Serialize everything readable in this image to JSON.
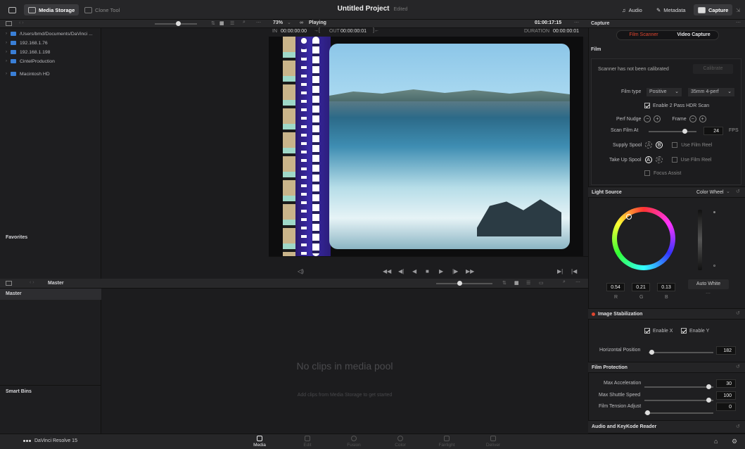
{
  "topbar": {
    "media_storage": "Media Storage",
    "clone_tool": "Clone Tool",
    "project_title": "Untitled Project",
    "edited": "Edited",
    "audio": "Audio",
    "metadata": "Metadata",
    "capture": "Capture"
  },
  "viewer": {
    "zoom": "73%",
    "playing": "Playing",
    "timecode": "01:00:17:15",
    "in_label": "IN",
    "in_tc": "00:00:00:00",
    "out_label": "OUT",
    "out_tc": "00:00:00:01",
    "duration_label": "DURATION",
    "duration_tc": "00:00:00:01"
  },
  "storage": {
    "items": [
      "/Users/bmd/Documents/DaVinci ...",
      "192.168.1.76",
      "192.168.1.198",
      "CintelProduction",
      "Macintosh HD"
    ],
    "favorites": "Favorites"
  },
  "media_pool": {
    "header": "Master",
    "bin": "Master",
    "smart_bins": "Smart Bins",
    "empty_title": "No clips in media pool",
    "empty_hint": "Add clips from Media Storage to get started"
  },
  "capture": {
    "title": "Capture",
    "tab_film": "Film Scanner",
    "tab_video": "Video Capture",
    "film_section": "Film",
    "calibration_msg": "Scanner has not been calibrated",
    "calibrate": "Calibrate",
    "film_type_label": "Film type",
    "film_type_value": "Positive",
    "film_format": "35mm 4-perf",
    "hdr_scan": "Enable 2 Pass HDR Scan",
    "perf_nudge": "Perf Nudge",
    "frame": "Frame",
    "scan_film_at": "Scan Film At",
    "fps_value": "24",
    "fps_unit": "FPS",
    "supply_spool": "Supply Spool",
    "take_up_spool": "Take Up Spool",
    "use_film_reel": "Use Film Reel",
    "focus_assist": "Focus Assist",
    "light_source": "Light Source",
    "color_wheel": "Color Wheel",
    "rgb": {
      "r": "0.54",
      "g": "0.21",
      "b": "0.13"
    },
    "r_lbl": "R",
    "g_lbl": "G",
    "b_lbl": "B",
    "auto_white": "Auto White",
    "image_stab": "Image Stabilization",
    "enable_x": "Enable X",
    "enable_y": "Enable Y",
    "horizontal_position": "Horizontal Position",
    "horizontal_value": "182",
    "film_protection": "Film Protection",
    "max_accel": "Max Acceleration",
    "max_accel_value": "30",
    "max_shuttle": "Max Shuttle Speed",
    "max_shuttle_value": "100",
    "film_tension": "Film Tension Adjust",
    "film_tension_value": "0",
    "audio_keykode": "Audio and KeyKode Reader"
  },
  "footer": {
    "app": "DaVinci Resolve 15",
    "tabs": [
      "Media",
      "Edit",
      "Fusion",
      "Color",
      "Fairlight",
      "Deliver"
    ]
  },
  "colors": {
    "accent_red": "#e0452f",
    "status_red": "#e0452f"
  }
}
